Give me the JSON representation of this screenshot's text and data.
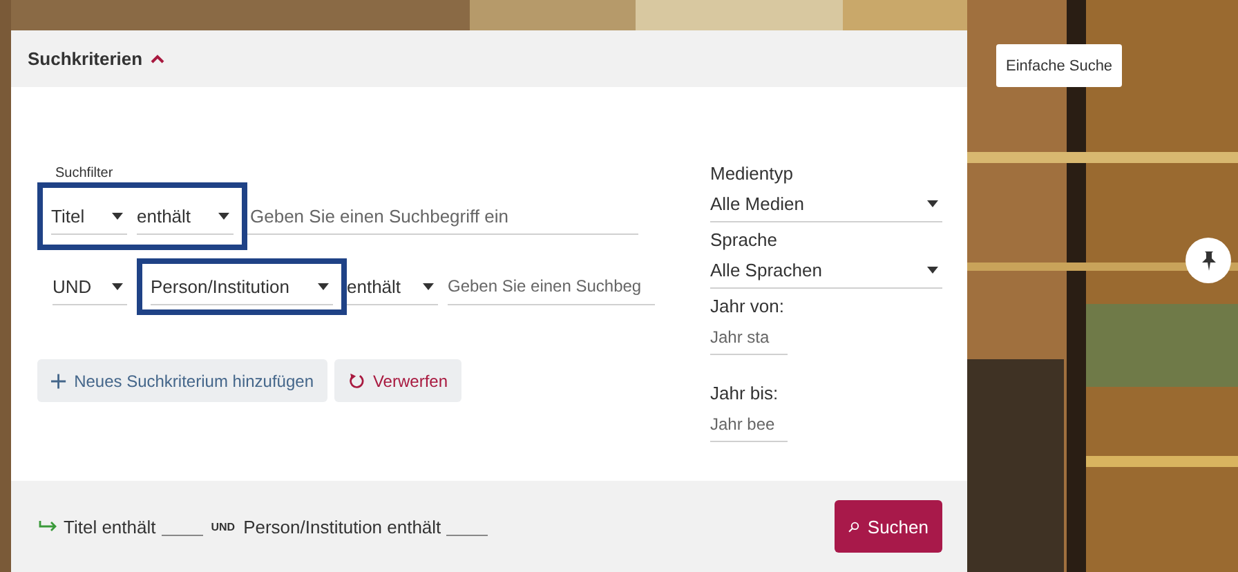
{
  "panel": {
    "title": "Suchkriterien",
    "expanded": true
  },
  "filter_label": "Suchfilter",
  "filter_rows": [
    {
      "fields": [
        {
          "kind": "select",
          "value": "Titel",
          "highlighted": true
        },
        {
          "kind": "select",
          "value": "enthält",
          "highlighted": true
        },
        {
          "kind": "input",
          "placeholder": "Geben Sie einen Suchbegriff ein",
          "highlighted": false
        }
      ]
    },
    {
      "fields": [
        {
          "kind": "select",
          "value": "UND",
          "highlighted": false
        },
        {
          "kind": "select",
          "value": "Person/Institution",
          "highlighted": true
        },
        {
          "kind": "select",
          "value": "enthält",
          "highlighted": false
        },
        {
          "kind": "input",
          "placeholder": "Geben Sie einen Suchbeg",
          "highlighted": false
        }
      ]
    }
  ],
  "add_button": "Neues Suchkriterium hinzufügen",
  "reset_button": "Verwerfen",
  "side_filters": [
    {
      "label": "Medientyp",
      "kind": "select",
      "value": "Alle Medien"
    },
    {
      "label": "Sprache",
      "kind": "select",
      "value": "Alle Sprachen"
    },
    {
      "label": "Jahr von:",
      "kind": "input",
      "placeholder": "Jahr sta"
    },
    {
      "label": "Jahr bis:",
      "kind": "input",
      "placeholder": "Jahr bee"
    }
  ],
  "summary": [
    {
      "kind": "text",
      "text": "Titel enthält"
    },
    {
      "kind": "blank"
    },
    {
      "kind": "operator",
      "text": "UND"
    },
    {
      "kind": "text",
      "text": "Person/Institution enthält"
    },
    {
      "kind": "blank"
    }
  ],
  "search_button": "Suchen",
  "simple_search_button": "Einfache Suche"
}
